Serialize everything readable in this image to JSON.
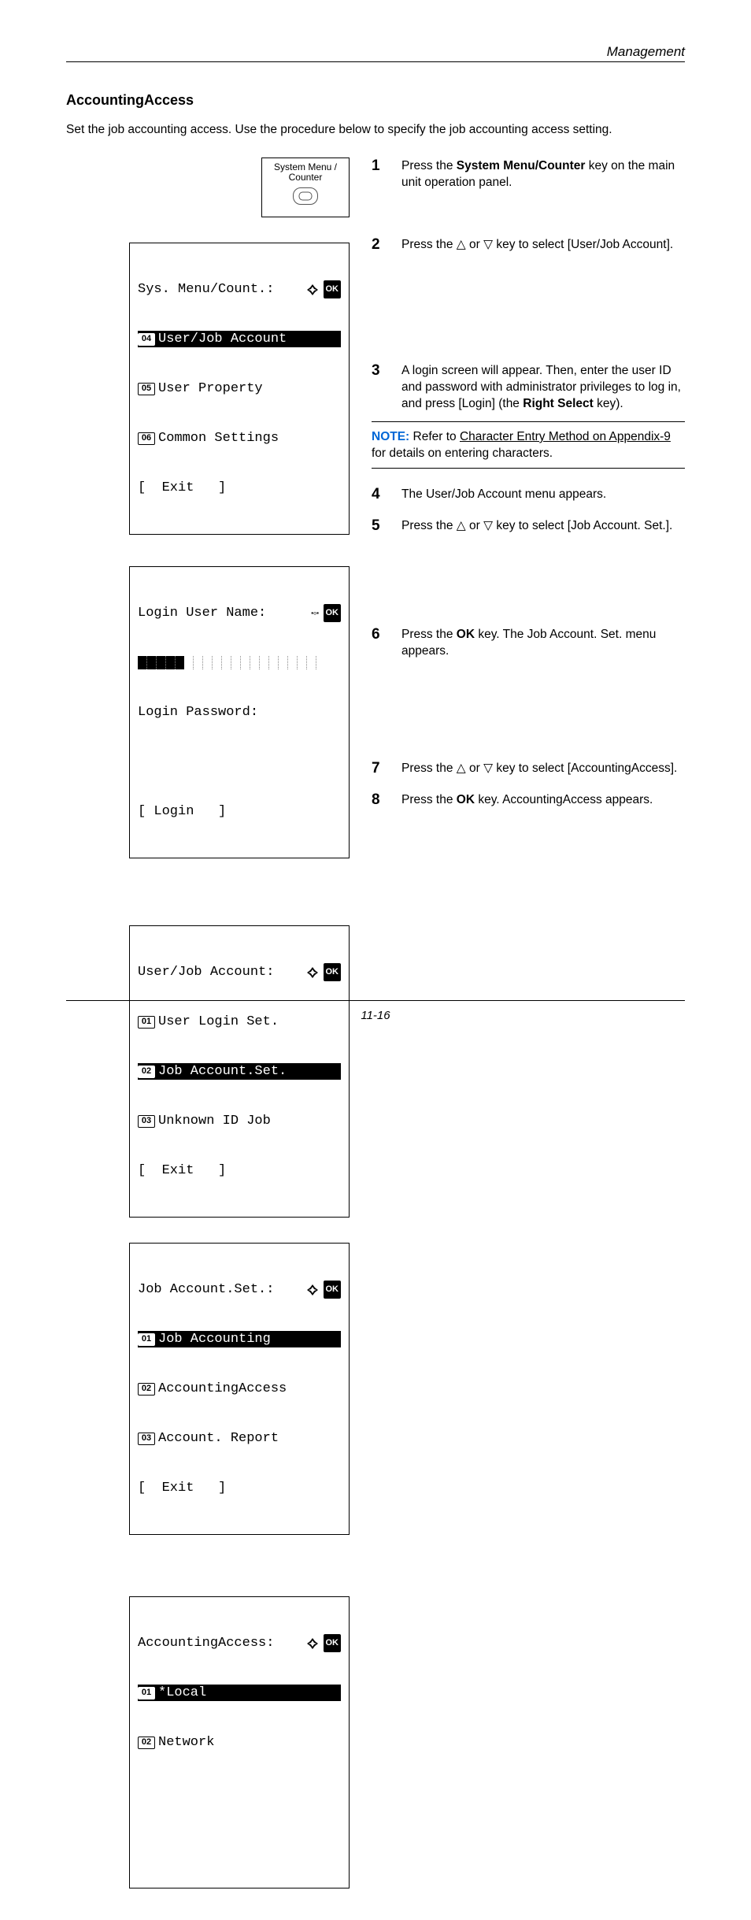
{
  "header": {
    "category": "Management"
  },
  "section": {
    "title": "AccountingAccess",
    "intro": "Set the job accounting access. Use the procedure below to specify the job accounting access setting."
  },
  "key_graphic": {
    "line1": "System Menu /",
    "line2": "Counter"
  },
  "screens": {
    "sys_menu": {
      "title": "Sys. Menu/Count.:",
      "items": [
        {
          "num": "04",
          "label": "User/Job Account",
          "selected": true
        },
        {
          "num": "05",
          "label": "User Property",
          "selected": false
        },
        {
          "num": "06",
          "label": "Common Settings",
          "selected": false
        }
      ],
      "softkey": "[  Exit   ]"
    },
    "login": {
      "title": "Login User Name:",
      "password_label": "Login Password:",
      "softkey": "[ Login   ]"
    },
    "user_job": {
      "title": "User/Job Account:",
      "items": [
        {
          "num": "01",
          "label": "User Login Set.",
          "selected": false
        },
        {
          "num": "02",
          "label": "Job Account.Set.",
          "selected": true
        },
        {
          "num": "03",
          "label": "Unknown ID Job",
          "selected": false
        }
      ],
      "softkey": "[  Exit   ]"
    },
    "job_acct_set": {
      "title": "Job Account.Set.:",
      "items": [
        {
          "num": "01",
          "label": "Job Accounting",
          "selected": true
        },
        {
          "num": "02",
          "label": "AccountingAccess",
          "selected": false
        },
        {
          "num": "03",
          "label": "Account. Report",
          "selected": false
        }
      ],
      "softkey": "[  Exit   ]"
    },
    "acct_access": {
      "title": "AccountingAccess:",
      "items": [
        {
          "num": "01",
          "label": "*Local",
          "selected": true
        },
        {
          "num": "02",
          "label": "Network",
          "selected": false
        }
      ]
    }
  },
  "steps": {
    "s1": {
      "num": "1",
      "text_pre": "Press the ",
      "bold": "System Menu/Counter",
      "text_post": " key on the main unit operation panel."
    },
    "s2": {
      "num": "2",
      "text": "Press the △ or ▽ key to select [User/Job Account]."
    },
    "s3": {
      "num": "3",
      "text_pre": "A login screen will appear. Then, enter the user ID and password with administrator privileges to log in, and press [Login] (the ",
      "bold": "Right Select",
      "text_post": " key)."
    },
    "s4": {
      "num": "4",
      "text": "The User/Job Account menu appears."
    },
    "s5": {
      "num": "5",
      "text": "Press the △ or ▽ key to select [Job Account. Set.]."
    },
    "s6": {
      "num": "6",
      "text_pre": "Press the ",
      "bold": "OK",
      "text_post": " key. The Job Account. Set. menu appears."
    },
    "s7": {
      "num": "7",
      "text": "Press the △ or ▽ key to select [AccountingAccess]."
    },
    "s8": {
      "num": "8",
      "text_pre": "Press the ",
      "bold": "OK",
      "text_post": " key. AccountingAccess appears."
    }
  },
  "note": {
    "label": "NOTE:",
    "pre": " Refer to ",
    "link": "Character Entry Method on Appendix-9",
    "post": " for details on entering characters."
  },
  "footer": {
    "page": "11-16"
  },
  "icons": {
    "ok": "OK"
  }
}
